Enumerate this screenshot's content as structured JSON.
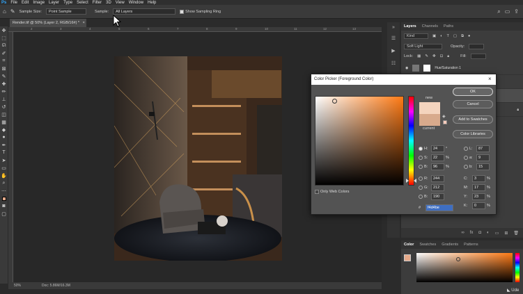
{
  "menubar": {
    "items": [
      "File",
      "Edit",
      "Image",
      "Layer",
      "Type",
      "Select",
      "Filter",
      "3D",
      "View",
      "Window",
      "Help"
    ]
  },
  "options": {
    "sample_size_label": "Sample Size:",
    "sample_size_value": "Point Sample",
    "sample_label": "Sample:",
    "sample_value": "All Layers",
    "show_ring_label": "Show Sampling Ring"
  },
  "document": {
    "tab_title": "Render.tif @ 50% (Layer 2, RGB/16#) *",
    "zoom": "50%",
    "doc_size": "Doc: 5.86M/16.3M"
  },
  "ruler_ticks": [
    "2",
    "3",
    "4",
    "5",
    "6",
    "7",
    "8",
    "9",
    "10",
    "11",
    "12",
    "13"
  ],
  "layers_panel": {
    "tabs": [
      "Layers",
      "Channels",
      "Paths"
    ],
    "kind_label": "Kind",
    "blend_mode": "Soft Light",
    "opacity_label": "Opacity:",
    "lock_label": "Lock:",
    "fill_label": "Fill:",
    "layer_name": "Hue/Saturation 1"
  },
  "color_panel": {
    "tabs": [
      "Color",
      "Swatches",
      "Gradients",
      "Patterns"
    ]
  },
  "dialog": {
    "title": "Color Picker (Foreground Color)",
    "new_label": "new",
    "current_label": "current",
    "ok_label": "OK",
    "cancel_label": "Cancel",
    "add_swatches_label": "Add to Swatches",
    "libraries_label": "Color Libraries",
    "only_web_label": "Only Web Colors",
    "hsb": [
      {
        "key": "H:",
        "value": "24",
        "unit": "°"
      },
      {
        "key": "S:",
        "value": "22",
        "unit": "%"
      },
      {
        "key": "B:",
        "value": "96",
        "unit": "%"
      }
    ],
    "rgb": [
      {
        "key": "R:",
        "value": "244"
      },
      {
        "key": "G:",
        "value": "212"
      },
      {
        "key": "B:",
        "value": "190"
      }
    ],
    "lab": [
      {
        "key": "L:",
        "value": "87"
      },
      {
        "key": "a:",
        "value": "9"
      },
      {
        "key": "b:",
        "value": "15"
      }
    ],
    "cmyk": [
      {
        "key": "C:",
        "value": "3",
        "unit": "%"
      },
      {
        "key": "M:",
        "value": "17",
        "unit": "%"
      },
      {
        "key": "Y:",
        "value": "23",
        "unit": "%"
      },
      {
        "key": "K:",
        "value": "0",
        "unit": "%"
      }
    ],
    "hex_label": "#",
    "hex_value": "f4d4be",
    "new_color": "#f4d4be",
    "current_color": "#d8aa8c"
  },
  "watermark": "Ude"
}
